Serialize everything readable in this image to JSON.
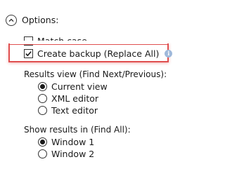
{
  "options": {
    "header_label": "Options:",
    "match_case": {
      "label": "Match case",
      "checked": false
    },
    "create_backup": {
      "label": "Create backup (Replace All)",
      "checked": true,
      "info_icon": "info-icon"
    },
    "results_view": {
      "heading": "Results view (Find Next/Previous):",
      "items": [
        {
          "label": "Current view",
          "selected": true
        },
        {
          "label": "XML editor",
          "selected": false
        },
        {
          "label": "Text editor",
          "selected": false
        }
      ]
    },
    "show_results_in": {
      "heading": "Show results in (Find All):",
      "items": [
        {
          "label": "Window 1",
          "selected": true
        },
        {
          "label": "Window 2",
          "selected": false
        }
      ]
    }
  },
  "colors": {
    "highlight": "#e05050",
    "info_icon": "#9fb9db"
  }
}
